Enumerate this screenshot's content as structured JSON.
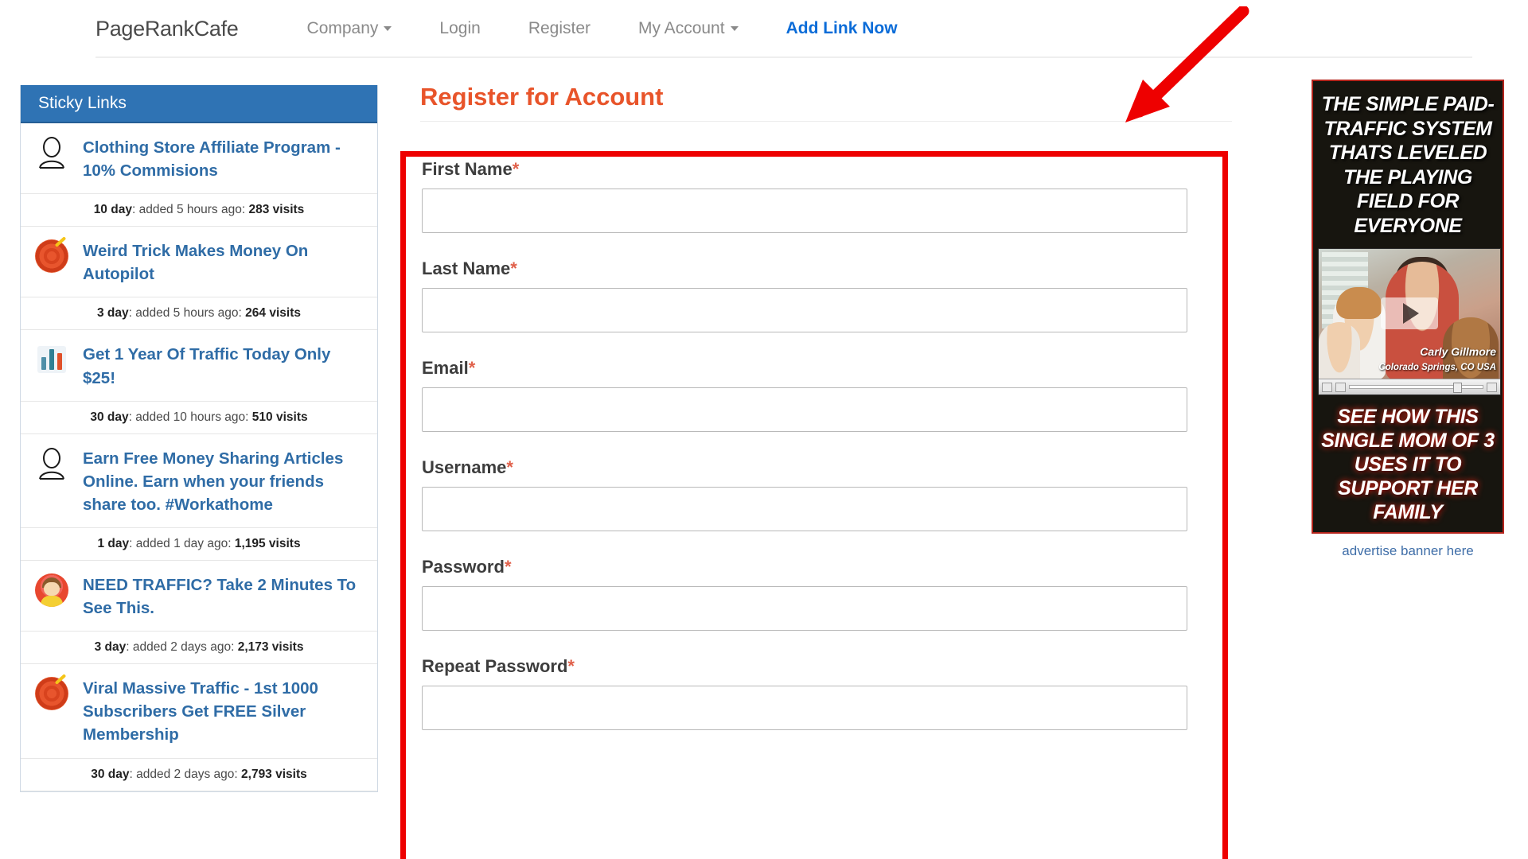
{
  "nav": {
    "brand": "PageRankCafe",
    "items": [
      {
        "label": "Company",
        "has_caret": true
      },
      {
        "label": "Login",
        "has_caret": false
      },
      {
        "label": "Register",
        "has_caret": false
      },
      {
        "label": "My Account",
        "has_caret": true
      }
    ],
    "cta": "Add Link Now"
  },
  "sidebar": {
    "header": "Sticky Links",
    "links": [
      {
        "icon": "person-icon",
        "title": "Clothing Store Affiliate Program - 10% Commisions",
        "stat": "10 day: added 5 hours ago: 283 visits",
        "period": "10 day",
        "added": "added 5 hours ago",
        "visits": "283 visits"
      },
      {
        "icon": "target-icon",
        "title": "Weird Trick Makes Money On Autopilot",
        "stat": "3 day: added 5 hours ago: 264 visits",
        "period": "3 day",
        "added": "added 5 hours ago",
        "visits": "264 visits"
      },
      {
        "icon": "bar-chart-icon",
        "title": "Get 1 Year Of Traffic Today Only $25!",
        "stat": "30 day: added 10 hours ago: 510 visits",
        "period": "30 day",
        "added": "added 10 hours ago",
        "visits": "510 visits"
      },
      {
        "icon": "person-icon",
        "title": "Earn Free Money Sharing Articles Online. Earn when your friends share too. #Workathome",
        "stat": "1 day: added 1 day ago: 1,195 visits",
        "period": "1 day",
        "added": "added 1 day ago",
        "visits": "1,195 visits"
      },
      {
        "icon": "avatar-icon",
        "title": "NEED TRAFFIC? Take 2 Minutes To See This.",
        "stat": "3 day: added 2 days ago: 2,173 visits",
        "period": "3 day",
        "added": "added 2 days ago",
        "visits": "2,173 visits"
      },
      {
        "icon": "target-icon",
        "title": "Viral Massive Traffic - 1st 1000 Subscribers Get FREE Silver Membership",
        "stat": "30 day: added 2 days ago: 2,793 visits",
        "period": "30 day",
        "added": "added 2 days ago",
        "visits": "2,793 visits"
      }
    ]
  },
  "main": {
    "title": "Register for Account",
    "fields": [
      {
        "label": "First Name",
        "required": "*",
        "value": "",
        "placeholder": ""
      },
      {
        "label": "Last Name",
        "required": "*",
        "value": "",
        "placeholder": ""
      },
      {
        "label": "Email",
        "required": "*",
        "value": "",
        "placeholder": ""
      },
      {
        "label": "Username",
        "required": "*",
        "value": "",
        "placeholder": ""
      },
      {
        "label": "Password",
        "required": "*",
        "value": "",
        "placeholder": ""
      },
      {
        "label": "Repeat Password",
        "required": "*",
        "value": "",
        "placeholder": ""
      }
    ]
  },
  "ad": {
    "headline": "THE SIMPLE PAID-TRAFFIC SYSTEM THATS LEVELED THE PLAYING FIELD FOR EVERYONE",
    "video_name": "Carly Gillmore",
    "video_location": "Colorado Springs, CO USA",
    "subline": "SEE HOW THIS SINGLE MOM OF 3 USES IT TO SUPPORT HER FAMILY",
    "link": "advertise banner here"
  },
  "annotation": {
    "box_color": "#ee0000",
    "arrow_color": "#ee0000"
  },
  "colors": {
    "sidebar_header": "#2f73b4",
    "link_blue": "#2f6ca6",
    "title_orange": "#e8542a",
    "cta_blue": "#0b6cd8"
  }
}
